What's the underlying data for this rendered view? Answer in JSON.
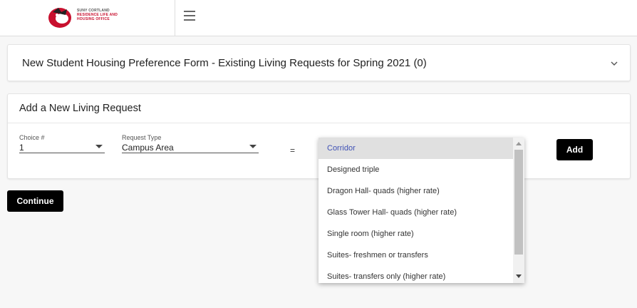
{
  "header": {
    "logo_lines": [
      "SUNY CORTLAND",
      "RESIDENCE LIFE AND",
      "HOUSING OFFICE"
    ],
    "menu_icon": "hamburger-icon"
  },
  "existing_requests": {
    "title": "New Student Housing Preference Form - Existing Living Requests for Spring 2021 (0)",
    "expand_icon": "chevron-down-icon"
  },
  "new_request": {
    "title": "Add a New Living Request",
    "choice_label": "Choice #",
    "choice_value": "1",
    "request_type_label": "Request Type",
    "request_type_value": "Campus Area",
    "equals": "=",
    "add_label": "Add"
  },
  "continue_label": "Continue",
  "dropdown": {
    "options": [
      "Corridor",
      "Designed triple",
      "Dragon Hall- quads (higher rate)",
      "Glass Tower Hall- quads (higher rate)",
      "Single room (higher rate)",
      "Suites- freshmen or transfers",
      "Suites- transfers only (higher rate)"
    ],
    "selected_index": 0
  },
  "colors": {
    "button_bg": "#000000",
    "selected_text": "#3f51b5",
    "logo_red": "#c8102e"
  }
}
